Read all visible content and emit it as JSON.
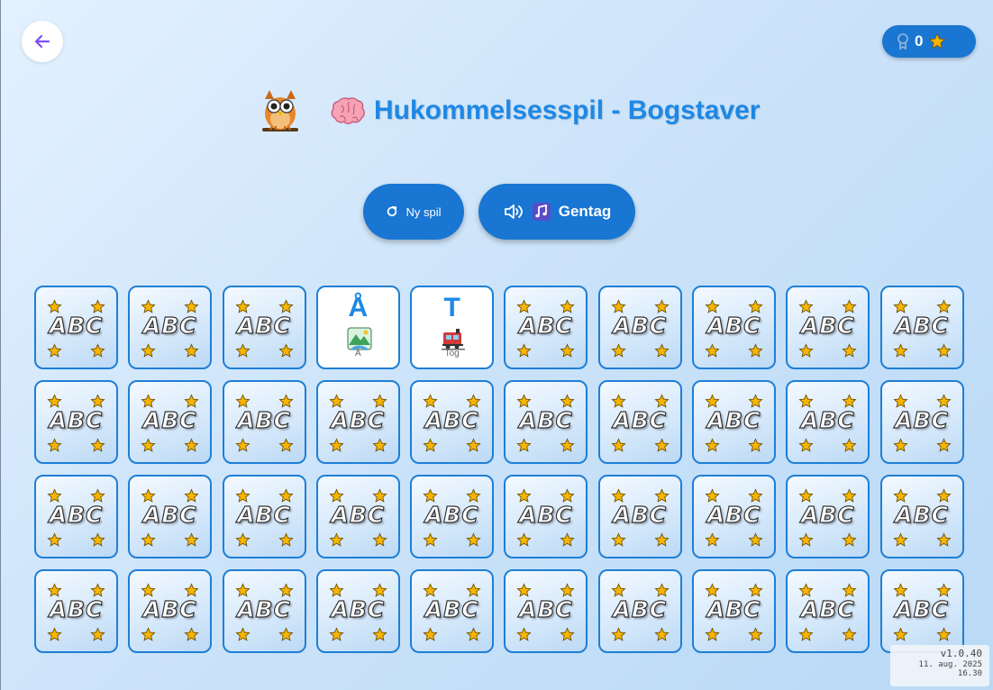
{
  "header": {
    "back_icon": "arrow-left-icon",
    "title": "Hukommelsesspil - Bogstaver",
    "mascot_icon": "owl-icon",
    "title_icon": "brain-icon"
  },
  "score": {
    "icon": "medal-icon",
    "value": "0",
    "star_icon": "star-icon"
  },
  "controls": {
    "new_game_label": "Ny spil",
    "new_game_icon": "refresh-icon",
    "repeat_label": "Gentag",
    "repeat_icons": [
      "speaker-icon",
      "music-note-icon"
    ]
  },
  "board": {
    "columns": 10,
    "rows": 4,
    "card_back_text": "ABC",
    "cards": [
      {
        "state": "hidden"
      },
      {
        "state": "hidden"
      },
      {
        "state": "hidden"
      },
      {
        "state": "revealed",
        "letter": "Å",
        "word": "Å",
        "picture": "river-landscape-icon"
      },
      {
        "state": "revealed",
        "letter": "T",
        "word": "Tog",
        "picture": "train-icon"
      },
      {
        "state": "hidden"
      },
      {
        "state": "hidden"
      },
      {
        "state": "hidden"
      },
      {
        "state": "hidden"
      },
      {
        "state": "hidden"
      },
      {
        "state": "hidden"
      },
      {
        "state": "hidden"
      },
      {
        "state": "hidden"
      },
      {
        "state": "hidden"
      },
      {
        "state": "hidden"
      },
      {
        "state": "hidden"
      },
      {
        "state": "hidden"
      },
      {
        "state": "hidden"
      },
      {
        "state": "hidden"
      },
      {
        "state": "hidden"
      },
      {
        "state": "hidden"
      },
      {
        "state": "hidden"
      },
      {
        "state": "hidden"
      },
      {
        "state": "hidden"
      },
      {
        "state": "hidden"
      },
      {
        "state": "hidden"
      },
      {
        "state": "hidden"
      },
      {
        "state": "hidden"
      },
      {
        "state": "hidden"
      },
      {
        "state": "hidden"
      },
      {
        "state": "hidden"
      },
      {
        "state": "hidden"
      },
      {
        "state": "hidden"
      },
      {
        "state": "hidden"
      },
      {
        "state": "hidden"
      },
      {
        "state": "hidden"
      },
      {
        "state": "hidden"
      },
      {
        "state": "hidden"
      },
      {
        "state": "hidden"
      },
      {
        "state": "hidden"
      }
    ]
  },
  "version": {
    "number": "v1.0.40",
    "date": "11. aug. 2025",
    "time": "16.30"
  },
  "colors": {
    "accent": "#1976d2",
    "title": "#1e88e5",
    "back_arrow": "#7c4dff",
    "star": "#f7b500"
  }
}
